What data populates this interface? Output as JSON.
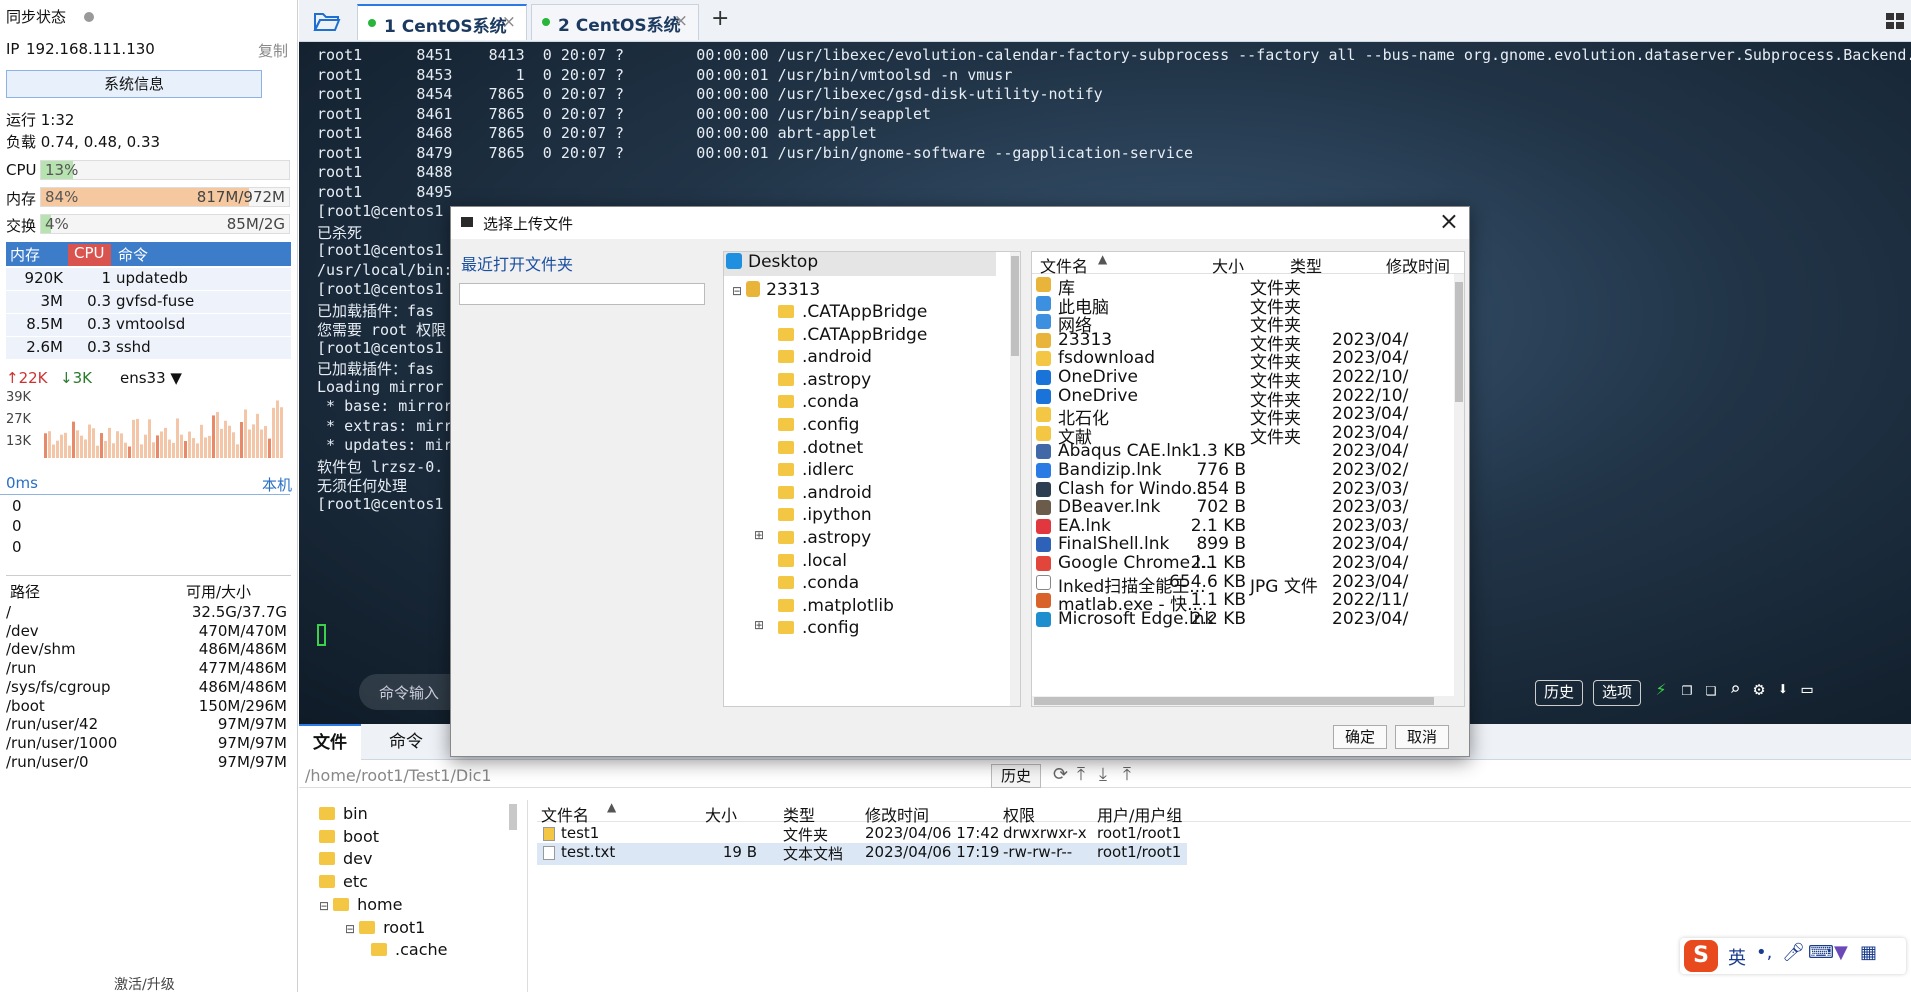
{
  "left": {
    "sync_label": "同步状态",
    "ip_label": "IP",
    "ip": "192.168.111.130",
    "copy": "复制",
    "sysinfo_btn": "系统信息",
    "uptime": "运行 1:32",
    "load": "负载 0.74, 0.48, 0.33",
    "cpu": {
      "label": "CPU",
      "pct": "13%",
      "fraction": 0.13
    },
    "mem": {
      "label": "内存",
      "pct": "84%",
      "val": "817M/972M",
      "fraction": 0.84
    },
    "swap": {
      "label": "交换",
      "pct": "4%",
      "val": "85M/2G",
      "fraction": 0.04
    },
    "proc_headers": [
      "内存",
      "CPU",
      "命令"
    ],
    "procs": [
      {
        "mem": "920K",
        "cpu": "1",
        "cmd": "updatedb"
      },
      {
        "mem": "3M",
        "cpu": "0.3",
        "cmd": "gvfsd-fuse"
      },
      {
        "mem": "8.5M",
        "cpu": "0.3",
        "cmd": "vmtoolsd"
      },
      {
        "mem": "2.6M",
        "cpu": "0.3",
        "cmd": "sshd"
      }
    ],
    "net": {
      "up": "22K",
      "down": "3K",
      "iface": "ens33",
      "levels": [
        "39K",
        "27K",
        "13K"
      ]
    },
    "latency": {
      "ms": "0ms",
      "host": "本机",
      "values": [
        "0",
        "0",
        "0"
      ]
    },
    "fs_headers": [
      "路径",
      "可用/大小"
    ],
    "fs": [
      {
        "path": "/",
        "size": "32.5G/37.7G"
      },
      {
        "path": "/dev",
        "size": "470M/470M"
      },
      {
        "path": "/dev/shm",
        "size": "486M/486M"
      },
      {
        "path": "/run",
        "size": "477M/486M"
      },
      {
        "path": "/sys/fs/cgroup",
        "size": "486M/486M"
      },
      {
        "path": "/boot",
        "size": "150M/296M"
      },
      {
        "path": "/run/user/42",
        "size": "97M/97M"
      },
      {
        "path": "/run/user/1000",
        "size": "97M/97M"
      },
      {
        "path": "/run/user/0",
        "size": "97M/97M"
      }
    ],
    "activate": "激活/升级"
  },
  "tabs": [
    {
      "label": "1 CentOS系统"
    },
    {
      "label": "2 CentOS系统"
    }
  ],
  "terminal": {
    "lines": [
      "root1      8451    8413  0 20:07 ?        00:00:00 /usr/libexec/evolution-calendar-factory-subprocess --factory all --bus-name org.gnome.evolution.dataserver.Subprocess.Backend.Cal",
      "root1      8453       1  0 20:07 ?        00:00:01 /usr/bin/vmtoolsd -n vmusr",
      "root1      8454    7865  0 20:07 ?        00:00:00 /usr/libexec/gsd-disk-utility-notify",
      "root1      8461    7865  0 20:07 ?        00:00:00 /usr/bin/seapplet",
      "root1      8468    7865  0 20:07 ?        00:00:00 abrt-applet",
      "root1      8479    7865  0 20:07 ?        00:00:01 /usr/bin/gnome-software --gapplication-service",
      "root1      8488",
      "root1      8495",
      "[root1@centos1",
      "已杀死",
      "[root1@centos1",
      "/usr/local/bin:",
      "[root1@centos1",
      "已加载插件：fas",
      "您需要 root 权限",
      "[root1@centos1",
      "已加载插件：fas",
      "Loading mirror",
      " * base: mirror",
      " * extras: mirr",
      " * updates: mir",
      "软件包 lrzsz-0.",
      "无须任何处理",
      "[root1@centos1"
    ],
    "cmd_placeholder": "命令输入",
    "history": "历史",
    "options": "选项"
  },
  "bottom": {
    "tab_files": "文件",
    "tab_cmd": "命令",
    "path": "/home/root1/Test1/Dic1",
    "history": "历史",
    "tree": [
      "bin",
      "boot",
      "dev",
      "etc",
      "home",
      "root1",
      ".cache"
    ],
    "headers": [
      "文件名",
      "大小",
      "类型",
      "修改时间",
      "权限",
      "用户/用户组"
    ],
    "files": [
      {
        "name": "test1",
        "size": "",
        "type": "文件夹",
        "mtime": "2023/04/06 17:42",
        "perm": "drwxrwxr-x",
        "owner": "root1/root1"
      },
      {
        "name": "test.txt",
        "size": "19 B",
        "type": "文本文档",
        "mtime": "2023/04/06 17:19",
        "perm": "-rw-rw-r--",
        "owner": "root1/root1"
      }
    ]
  },
  "dialog": {
    "title": "选择上传文件",
    "recent": "最近打开文件夹",
    "ok": "确定",
    "cancel": "取消",
    "tree_root": "Desktop",
    "tree_user": "23313",
    "tree_items": [
      ".CATAppBridge",
      ".CATAppBridge",
      ".android",
      ".astropy",
      ".conda",
      ".config",
      ".dotnet",
      ".idlerc",
      ".android",
      ".ipython",
      ".astropy",
      ".local",
      ".conda",
      ".matplotlib",
      ".config"
    ],
    "headers": [
      "文件名",
      "大小",
      "类型",
      "修改时间"
    ],
    "files": [
      {
        "name": "库",
        "size": "",
        "type": "文件夹",
        "mtime": "",
        "icon": "library-icon",
        "color": "#e8b53a"
      },
      {
        "name": "此电脑",
        "size": "",
        "type": "文件夹",
        "mtime": "",
        "icon": "computer-icon",
        "color": "#3d8fe0"
      },
      {
        "name": "网络",
        "size": "",
        "type": "文件夹",
        "mtime": "",
        "icon": "network-icon",
        "color": "#3d8fe0"
      },
      {
        "name": "23313",
        "size": "",
        "type": "文件夹",
        "mtime": "2023/04/",
        "icon": "user-folder-icon",
        "color": "#e8b53a"
      },
      {
        "name": "fsdownload",
        "size": "",
        "type": "文件夹",
        "mtime": "2023/04/",
        "icon": "folder-icon",
        "color": "#f3c744"
      },
      {
        "name": "OneDrive",
        "size": "",
        "type": "文件夹",
        "mtime": "2022/10/",
        "icon": "onedrive-icon",
        "color": "#1a73d9"
      },
      {
        "name": "OneDrive",
        "size": "",
        "type": "文件夹",
        "mtime": "2022/10/",
        "icon": "onedrive-icon",
        "color": "#1a73d9"
      },
      {
        "name": "北石化",
        "size": "",
        "type": "文件夹",
        "mtime": "2023/04/",
        "icon": "folder-icon",
        "color": "#f3c744"
      },
      {
        "name": "文献",
        "size": "",
        "type": "文件夹",
        "mtime": "2023/04/",
        "icon": "folder-icon",
        "color": "#f3c744"
      },
      {
        "name": "Abaqus CAE.lnk",
        "size": "1.3 KB",
        "type": "",
        "mtime": "2023/04/",
        "icon": "abaqus-icon",
        "color": "#4169a8"
      },
      {
        "name": "Bandizip.lnk",
        "size": "776 B",
        "type": "",
        "mtime": "2023/02/",
        "icon": "bandizip-icon",
        "color": "#2b7be4"
      },
      {
        "name": "Clash for Windo...",
        "size": "854 B",
        "type": "",
        "mtime": "2023/03/",
        "icon": "clash-icon",
        "color": "#2c3e50"
      },
      {
        "name": "DBeaver.lnk",
        "size": "702 B",
        "type": "",
        "mtime": "2023/03/",
        "icon": "dbeaver-icon",
        "color": "#6b5b4a"
      },
      {
        "name": "EA.lnk",
        "size": "2.1 KB",
        "type": "",
        "mtime": "2023/03/",
        "icon": "ea-icon",
        "color": "#e0383e"
      },
      {
        "name": "FinalShell.lnk",
        "size": "899 B",
        "type": "",
        "mtime": "2023/04/",
        "icon": "finalshell-icon",
        "color": "#2d62b8"
      },
      {
        "name": "Google Chrome.l...",
        "size": "2.1 KB",
        "type": "",
        "mtime": "2023/04/",
        "icon": "chrome-icon",
        "color": "#e2463a"
      },
      {
        "name": "Inked扫描全能王...",
        "size": "654.6 KB",
        "type": "JPG 文件",
        "mtime": "2023/04/",
        "icon": "image-icon",
        "color": "#ffffff"
      },
      {
        "name": "matlab.exe - 快...",
        "size": "1.1 KB",
        "type": "",
        "mtime": "2022/11/",
        "icon": "matlab-icon",
        "color": "#d9622b"
      },
      {
        "name": "Microsoft Edge.lnk",
        "size": "2.2 KB",
        "type": "",
        "mtime": "2023/04/",
        "icon": "edge-icon",
        "color": "#1f8ecf"
      }
    ]
  },
  "ime": {
    "lang": "英"
  }
}
